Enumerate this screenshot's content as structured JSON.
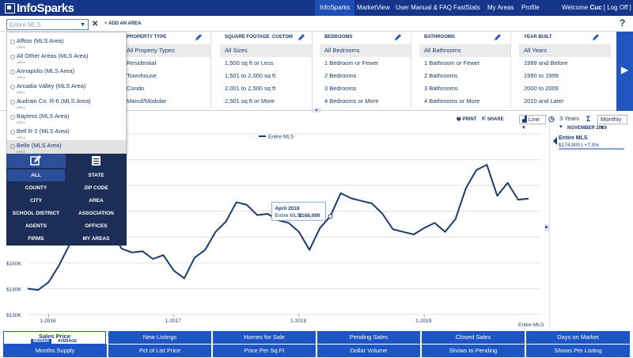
{
  "app": {
    "logo": "InfoSparks"
  },
  "nav": {
    "items": [
      "InfoSparks",
      "MarketView",
      "User Manual & FAQ",
      "FastStats",
      "My Areas",
      "Profile"
    ],
    "welcome": "Welcome",
    "user": "Cuc",
    "logoff": "[ Log Off ]"
  },
  "area_bar": {
    "placeholder": "Entire MLS",
    "add_area": "+ ADD AN AREA",
    "help": "?"
  },
  "filters": {
    "property_type": {
      "header": "PROPERTY TYPE",
      "options": [
        "All Property Types",
        "Residential",
        "Townhouse",
        "Condo",
        "Manuf/Modular"
      ]
    },
    "square_footage": {
      "header": "SQUARE FOOTAGE",
      "custom": "CUSTOM",
      "options": [
        "All Sizes",
        "1,500 sq ft or Less",
        "1,501 to 2,000 sq ft",
        "2,001 to 2,500 sq ft",
        "2,501 sq ft or More"
      ]
    },
    "bedrooms": {
      "header": "BEDROOMS",
      "options": [
        "All Bedrooms",
        "1 Bedroom or Fewer",
        "2 Bedrooms",
        "3 Bedrooms",
        "4 Bedrooms or More"
      ]
    },
    "bathrooms": {
      "header": "BATHROOMS",
      "options": [
        "All Bathrooms",
        "1 Bathroom or Fewer",
        "2 Bathrooms",
        "3 Bathrooms",
        "4 Bathrooms or More"
      ]
    },
    "year_built": {
      "header": "YEAR BUILT",
      "options": [
        "All Years",
        "1989 and Before",
        "1990 to 1999",
        "2000 to 2009",
        "2010 and Later"
      ]
    }
  },
  "dropdown": {
    "items": [
      {
        "name": "Affton (MLS Area)",
        "sub": "AREA"
      },
      {
        "name": "All Other Areas (MLS Area)",
        "sub": "AREA"
      },
      {
        "name": "Annapolis (MLS Area)",
        "sub": "AREA"
      },
      {
        "name": "Arcadia Valley (MLS Area)",
        "sub": "AREA"
      },
      {
        "name": "Audrain Co. R-6 (MLS Area)",
        "sub": "AREA"
      },
      {
        "name": "Bayless (MLS Area)",
        "sub": "AREA"
      },
      {
        "name": "Bell R-2 (MLS Area)",
        "sub": "AREA"
      },
      {
        "name": "Belle (MLS Area)",
        "sub": "AREA"
      }
    ]
  },
  "area_types": [
    "ALL",
    "STATE",
    "COUNTY",
    "ZIP CODE",
    "CITY",
    "AREA",
    "SCHOOL DISTRICT",
    "ASSOCIATION",
    "AGENTS",
    "OFFICES",
    "FIRMS",
    "MY AREAS"
  ],
  "chart_controls": {
    "print": "PRINT",
    "share": "SHARE",
    "chart_type": "Line",
    "range": "3 Years",
    "interval": "Monthly"
  },
  "right_panel": {
    "date": "NOVEMBER 2019",
    "title": "Entire MLS",
    "value": "$174,900 | +7.0%"
  },
  "chart_data": {
    "type": "line",
    "title": "",
    "legend": [
      "Entire MLS"
    ],
    "watermark": "Entire MLS",
    "xlabel": "",
    "ylabel": "",
    "x_ticks": [
      "1-2016",
      "1-2017",
      "1-2018",
      "1-2019"
    ],
    "y_ticks": [
      "$130K",
      "$140K",
      "$150K"
    ],
    "ylim": [
      130000,
      200000
    ],
    "grid": true,
    "tooltip": {
      "date": "April 2018",
      "label": "Entire MLS:",
      "value": "$168,000"
    },
    "series": [
      {
        "name": "Entire MLS",
        "x": [
          "2015-11",
          "2015-12",
          "2016-01",
          "2016-02",
          "2016-03",
          "2016-04",
          "2016-05",
          "2016-06",
          "2016-07",
          "2016-08",
          "2016-09",
          "2016-10",
          "2016-11",
          "2016-12",
          "2017-01",
          "2017-02",
          "2017-03",
          "2017-04",
          "2017-05",
          "2017-06",
          "2017-07",
          "2017-08",
          "2017-09",
          "2017-10",
          "2017-11",
          "2017-12",
          "2018-01",
          "2018-02",
          "2018-03",
          "2018-04",
          "2018-05",
          "2018-06",
          "2018-07",
          "2018-08",
          "2018-09",
          "2018-10",
          "2018-11",
          "2018-12",
          "2019-01",
          "2019-02",
          "2019-03",
          "2019-04",
          "2019-05",
          "2019-06",
          "2019-07",
          "2019-08",
          "2019-09",
          "2019-10",
          "2019-11"
        ],
        "values": [
          140000,
          139500,
          142500,
          149000,
          157000,
          168000,
          172500,
          164000,
          162500,
          155500,
          154000,
          154500,
          151500,
          153000,
          147000,
          144000,
          152000,
          155000,
          162000,
          166000,
          173500,
          172500,
          168500,
          169000,
          166500,
          165500,
          162000,
          155000,
          163500,
          168000,
          177000,
          175000,
          174000,
          173000,
          169000,
          163000,
          162000,
          161000,
          163500,
          165500,
          162000,
          167000,
          179000,
          186000,
          188000,
          176000,
          181000,
          174500,
          174900
        ]
      }
    ]
  },
  "bottom_tabs": {
    "row1": [
      "Sales Price",
      "New Listings",
      "Homes for Sale",
      "Pending Sales",
      "Closed Sales",
      "Days on Market"
    ],
    "row2": [
      "Months Supply",
      "Pct of List Price",
      "Price Per Sq Ft",
      "Dollar Volume",
      "Shows to Pending",
      "Shows Per Listing"
    ],
    "toggle": [
      "MEDIAN",
      "AVERAGE"
    ]
  },
  "colors": {
    "nav": "#14358a",
    "accent": "#1d55c4",
    "line": "#1b3b6f",
    "panel": "#1c2d57"
  }
}
